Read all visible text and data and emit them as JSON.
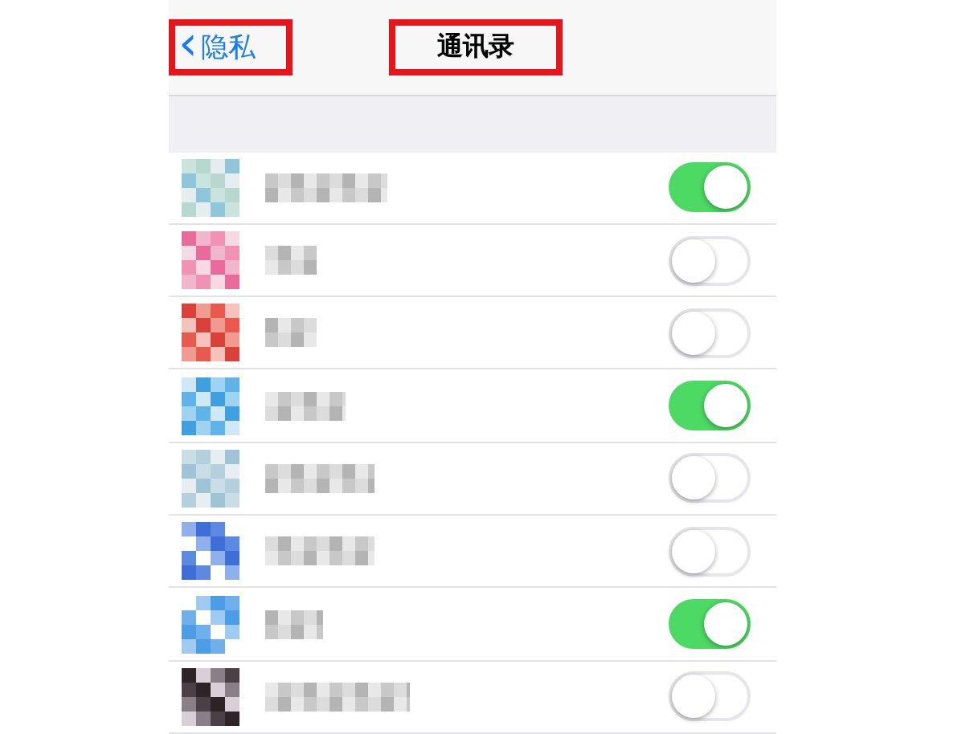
{
  "nav_bar": {
    "back": {
      "icon": "‹",
      "label": "隐私"
    },
    "title": "通讯录"
  },
  "rows": [
    {
      "on": true
    },
    {
      "on": false
    },
    {
      "on": false
    },
    {
      "on": true
    },
    {
      "on": false
    },
    {
      "on": false
    },
    {
      "on": true
    },
    {
      "on": false
    }
  ]
}
